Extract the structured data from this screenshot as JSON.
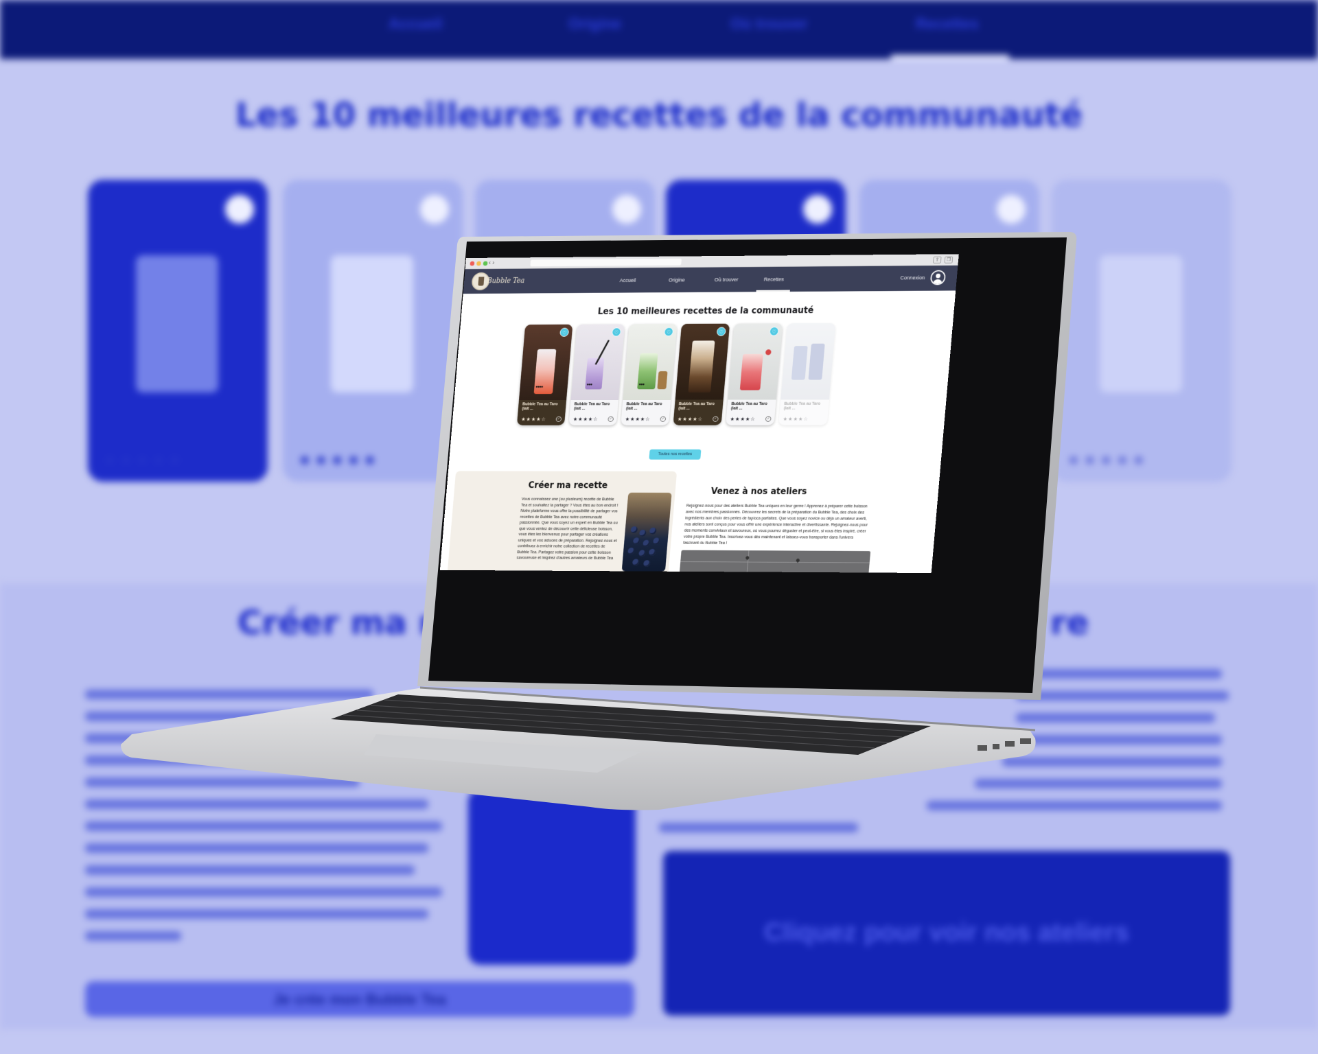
{
  "background": {
    "nav": [
      "Accueil",
      "Origine",
      "Où trouver",
      "Recettes"
    ],
    "title": "Les 10 meilleures recettes de la communauté",
    "h2_left": "Créer ma rec",
    "h2_right": "re",
    "map_text": "Cliquez pour voir nos ateliers",
    "button_text": "Je crée mon Bubble Tea"
  },
  "browser": {
    "back": "‹",
    "forward": "›",
    "share_icon": "share-icon",
    "tabs_icon": "tabs-icon"
  },
  "site": {
    "logo_text": "Bubble Tea",
    "nav": [
      {
        "label": "Accueil"
      },
      {
        "label": "Origine"
      },
      {
        "label": "Où trouver"
      },
      {
        "label": "Recettes",
        "active": true
      }
    ],
    "login": "Connexion",
    "section_title": "Les 10 meilleures recettes de la communauté",
    "recipes": [
      {
        "name": "Bubble Tea au Taro (lait ...",
        "rating": 3.5,
        "stars": "★★★★☆",
        "theme": "dark"
      },
      {
        "name": "Bubble Tea au Taro (lait ...",
        "rating": 3.5,
        "stars": "★★★★☆",
        "theme": "light"
      },
      {
        "name": "Bubble Tea au Taro (lait ...",
        "rating": 3.5,
        "stars": "★★★★☆",
        "theme": "light"
      },
      {
        "name": "Bubble Tea au Taro (lait ...",
        "rating": 3.5,
        "stars": "★★★★☆",
        "theme": "dark"
      },
      {
        "name": "Bubble Tea au Taro (lait ...",
        "rating": 3.5,
        "stars": "★★★★☆",
        "theme": "light"
      },
      {
        "name": "Bubble Tea au Taro (lait ...",
        "rating": 3.5,
        "stars": "★★★★☆",
        "theme": "faded"
      }
    ],
    "all_recipes_button": "Toutes nos recettes",
    "create": {
      "title": "Créer ma recette",
      "text": "Vous connaissez une (ou plusieurs) recette de Bubble Tea et souhaitez la partager ? Vous êtes au bon endroit ! Notre plateforme vous offre la possibilité de partager vos recettes de Bubble Tea avec notre communauté passionnée. Que vous soyez un expert en Bubble Tea ou que vous veniez de découvrir cette délicieuse boisson, vous êtes les bienvenus pour partager vos créations uniques et vos astuces de préparation. Rejoignez-nous et contribuez à enrichir notre collection de recettes de Bubble Tea. Partagez votre passion pour cette boisson savoureuse et inspirez d'autres amateurs de Bubble Tea"
    },
    "ateliers": {
      "title": "Venez à nos ateliers",
      "text": "Rejoignez-nous pour des ateliers Bubble Tea uniques en leur genre ! Apprenez à préparer cette boisson avec nos membres passionnés. Découvrez les secrets de la préparation du Bubble Tea, des choix des ingrédients aux choix des perles de tapioca parfaites. Que vous soyez novice ou déjà un amateur averti, nos ateliers sont conçus pour vous offrir une expérience interactive et divertissante. Rejoignez-nous pour des moments conviviaux et savoureux, où vous pourrez déguster et peut-être, si vous êtes inspiré, créer votre propre Bubble Tea. Inscrivez-vous dès maintenant et laissez-vous transporter dans l'univers fascinant du Bubble Tea !"
    }
  },
  "colors": {
    "nav_bg": "#3b4058",
    "accent": "#5fd1e8",
    "bg_tint": "#c3c8f3",
    "bg_dark_blue": "#0c1a78"
  }
}
